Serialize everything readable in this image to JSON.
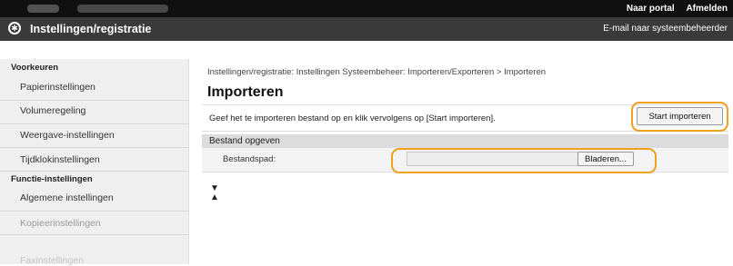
{
  "topbar": {
    "portal_link": "Naar portal",
    "logout_link": "Afmelden"
  },
  "titlebar": {
    "logo_icon": "canon-logo-icon",
    "title": "Instellingen/registratie",
    "email_link": "E-mail naar systeembeheerder"
  },
  "sidebar": {
    "section1": "Voorkeuren",
    "items1": [
      "Papierinstellingen",
      "Volumeregeling",
      "Weergave-instellingen",
      "Tijdklokinstellingen"
    ],
    "section2": "Functie-instellingen",
    "items2": [
      "Algemene instellingen",
      "Kopieerinstellingen",
      "Faxinstellingen"
    ]
  },
  "main": {
    "breadcrumb": "Instellingen/registratie: Instellingen Systeembeheer: Importeren/Exporteren > Importeren",
    "heading": "Importeren",
    "instruction": "Geef het te importeren bestand op en klik vervolgens op [Start importeren].",
    "start_button": "Start importeren",
    "section_title": "Bestand opgeven",
    "file_path_label": "Bestandspad:",
    "file_path_value": "",
    "browse_button": "Bladeren...",
    "end_icon": "end-of-page-icon"
  },
  "colors": {
    "highlight": "#f0a01e",
    "topbar": "#101010",
    "titlebar": "#3a3a3a",
    "sidebar": "#efefef"
  }
}
